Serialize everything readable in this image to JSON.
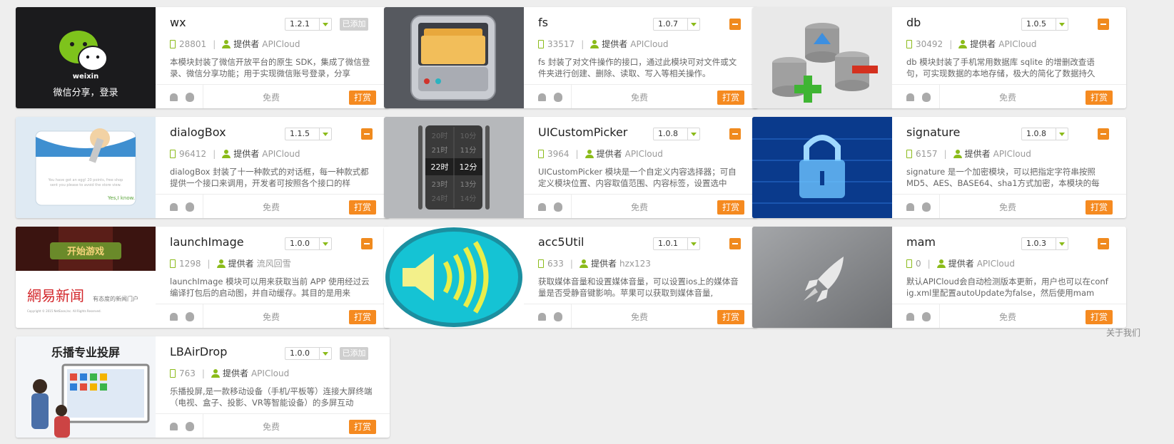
{
  "labels": {
    "free": "免费",
    "tip": "打赏",
    "added": "已添加",
    "provider": "提供者"
  },
  "footer": {
    "about": "关于我们"
  },
  "modules": [
    {
      "name": "wx",
      "version": "1.2.1",
      "downloads": "28801",
      "provider": "APICloud",
      "description": "本模块封装了微信开放平台的原生 SDK，集成了微信登录、微信分享功能；用于实现微信账号登录，分享",
      "status": "added",
      "thumb_text": [
        "weixin",
        "微信分享，登录"
      ]
    },
    {
      "name": "fs",
      "version": "1.0.7",
      "downloads": "33517",
      "provider": "APICloud",
      "description": "fs 封装了对文件操作的接口，通过此模块可对文件或文件夹进行创建、删除、读取、写入等相关操作。",
      "status": "remove",
      "thumb_text": []
    },
    {
      "name": "db",
      "version": "1.0.5",
      "downloads": "30492",
      "provider": "APICloud",
      "description": "db 模块封装了手机常用数据库 sqlite 的增删改查语句，可实现数据的本地存储，极大的简化了数据持久",
      "status": "remove",
      "thumb_text": []
    },
    {
      "name": "dialogBox",
      "version": "1.1.5",
      "downloads": "96412",
      "provider": "APICloud",
      "description": "dialogBox 封装了十一种款式的对话框，每一种款式都提供一个接口来调用，开发者可按照各个接口的样",
      "status": "remove",
      "thumb_text": [
        "You have got an egg! 20 points, free shop",
        "sent you please to avoid the store view.",
        "Yes,I know."
      ]
    },
    {
      "name": "UICustomPicker",
      "version": "1.0.8",
      "downloads": "3964",
      "provider": "APICloud",
      "description": "UICustomPicker 模块是一个自定义内容选择器；可自定义模块位置、内容取值范围、内容标签，设置选中",
      "status": "remove",
      "thumb_text": [
        "20时",
        "10分",
        "21时",
        "11分",
        "22时",
        "12分",
        "23时",
        "13分",
        "24时",
        "14分"
      ]
    },
    {
      "name": "signature",
      "version": "1.0.8",
      "downloads": "6157",
      "provider": "APICloud",
      "description": "signature 是一个加密模块，可以把指定字符串按照MD5、AES、BASE64、sha1方式加密，本模块的每",
      "status": "remove",
      "thumb_text": []
    },
    {
      "name": "launchImage",
      "version": "1.0.0",
      "downloads": "1298",
      "provider": "流风回雪",
      "description": "launchImage 模块可以用来获取当前 APP 使用经过云编译打包后的启动图，并自动缓存。其目的是用来",
      "status": "remove",
      "thumb_text": [
        "开始游戏",
        "網易新闻",
        "有态度的新闻门户",
        "Copyright © 2015 NetEase,Inc. All Rights Reserved."
      ]
    },
    {
      "name": "acc5Util",
      "version": "1.0.1",
      "downloads": "633",
      "provider": "hzx123",
      "description": "获取媒体音量和设置媒体音量，可以设置ios上的媒体音量是否受静音键影响。苹果可以获取到媒体音量,",
      "status": "remove",
      "thumb_text": []
    },
    {
      "name": "mam",
      "version": "1.0.3",
      "downloads": "0",
      "provider": "APICloud",
      "description": "默认APICloud会自动检测版本更新，用户也可以在config.xml里配置autoUpdate为false，然后使用mam",
      "status": "remove",
      "thumb_text": []
    },
    {
      "name": "LBAirDrop",
      "version": "1.0.0",
      "downloads": "763",
      "provider": "APICloud",
      "description": "乐播投屏,是一款移动设备（手机/平板等）连接大屏终端（电视、盒子、投影、VR等智能设备）的多屏互动",
      "status": "added",
      "thumb_text": [
        "乐播专业投屏"
      ]
    }
  ]
}
